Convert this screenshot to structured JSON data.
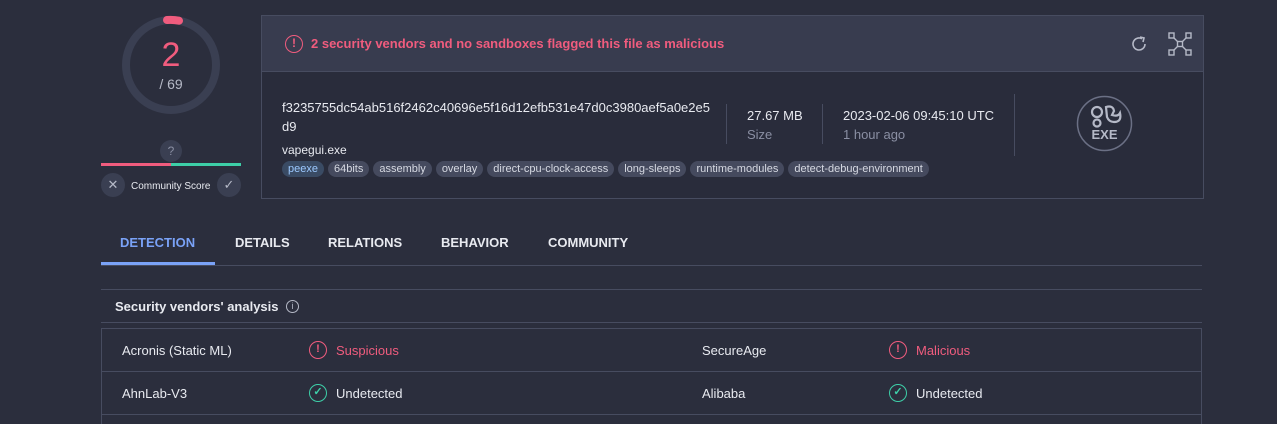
{
  "score": {
    "detections": "2",
    "total": "/ 69"
  },
  "community": {
    "question": "?",
    "label": "Community Score",
    "dislike": "✕",
    "like": "✓"
  },
  "banner": {
    "icon": "!",
    "text": "2 security vendors and no sandboxes flagged this file as malicious"
  },
  "toolbar": {
    "reanalyze_icon": "refresh-icon",
    "similar_icon": "graph-icon"
  },
  "file": {
    "hash": "f3235755dc54ab516f2462c40696e5f16d12efb531e47d0c3980aef5a0e2e5d9",
    "name": "vapegui.exe",
    "tags": [
      "peexe",
      "64bits",
      "assembly",
      "overlay",
      "direct-cpu-clock-access",
      "long-sleeps",
      "runtime-modules",
      "detect-debug-environment"
    ],
    "size_value": "27.67 MB",
    "size_label": "Size",
    "date_value": "2023-02-06 09:45:10 UTC",
    "date_label": "1 hour ago",
    "type_badge": "EXE"
  },
  "tabs": [
    "DETECTION",
    "DETAILS",
    "RELATIONS",
    "BEHAVIOR",
    "COMMUNITY"
  ],
  "active_tab": "DETECTION",
  "analysis": {
    "title": "Security vendors' analysis",
    "info_icon": "i",
    "rows": [
      {
        "vendor1": "Acronis (Static ML)",
        "result1": "Suspicious",
        "status1": "malicious",
        "vendor2": "SecureAge",
        "result2": "Malicious",
        "status2": "malicious"
      },
      {
        "vendor1": "AhnLab-V3",
        "result1": "Undetected",
        "status1": "clean",
        "vendor2": "Alibaba",
        "result2": "Undetected",
        "status2": "clean"
      }
    ]
  },
  "colors": {
    "malicious": "#f05c7e",
    "clean": "#3dcfa8",
    "accent": "#7aa2f7",
    "background": "#2b2e3d"
  },
  "score_fill_fraction": 0.029
}
